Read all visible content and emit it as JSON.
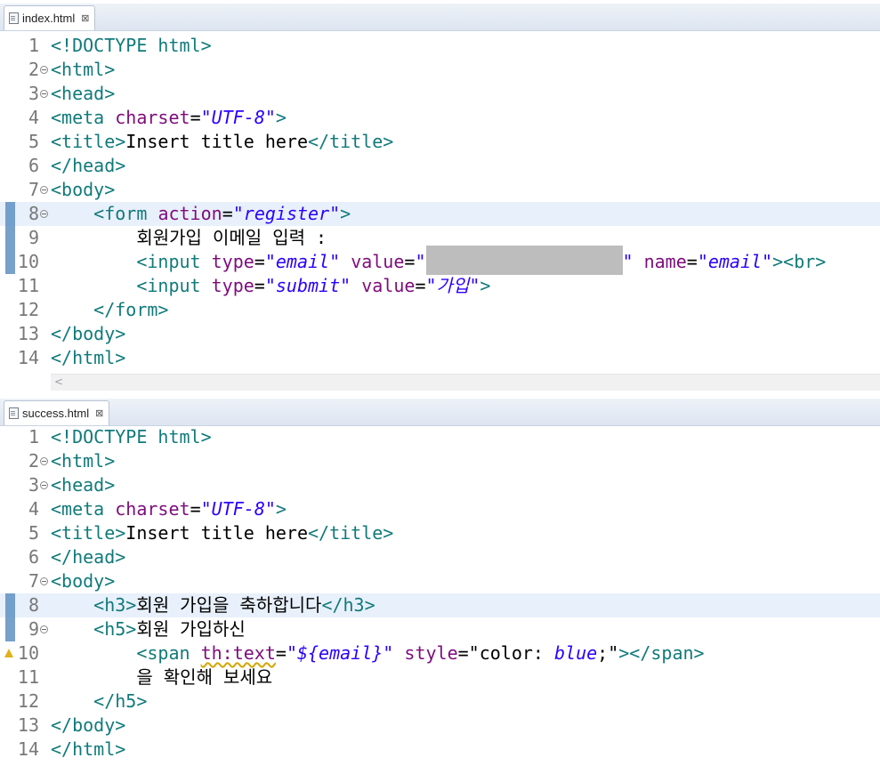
{
  "editors": [
    {
      "tab": "index.html",
      "lines": [
        {
          "n": "1",
          "fold": false,
          "mark": false,
          "html": "<span class=\"t\">&lt;!DOCTYPE</span> <span class=\"t\">html</span><span class=\"t\">&gt;</span>"
        },
        {
          "n": "2",
          "fold": true,
          "mark": false,
          "html": "<span class=\"t\">&lt;html&gt;</span>"
        },
        {
          "n": "3",
          "fold": true,
          "mark": false,
          "html": "<span class=\"t\">&lt;head&gt;</span>"
        },
        {
          "n": "4",
          "fold": false,
          "mark": false,
          "html": "<span class=\"t\">&lt;meta</span> <span class=\"a\">charset</span>=<span class=\"v\">\"UTF-8\"</span><span class=\"t\">&gt;</span>"
        },
        {
          "n": "5",
          "fold": false,
          "mark": false,
          "html": "<span class=\"t\">&lt;title&gt;</span>Insert title here<span class=\"t\">&lt;/title&gt;</span>"
        },
        {
          "n": "6",
          "fold": false,
          "mark": false,
          "html": "<span class=\"t\">&lt;/head&gt;</span>"
        },
        {
          "n": "7",
          "fold": true,
          "mark": false,
          "html": "<span class=\"t\">&lt;body&gt;</span>"
        },
        {
          "n": "8",
          "fold": true,
          "mark": true,
          "hl": true,
          "html": "    <span class=\"t\">&lt;form</span> <span class=\"a\">action</span>=<span class=\"v\">\"register\"</span><span class=\"t\">&gt;</span>"
        },
        {
          "n": "9",
          "fold": false,
          "mark": true,
          "html": "        회원가입 이메일 입력 :"
        },
        {
          "n": "10",
          "fold": false,
          "mark": true,
          "html": "        <span class=\"t\">&lt;input</span> <span class=\"a\">type</span>=<span class=\"v\">\"email\"</span> <span class=\"a\">value</span>=<span class=\"v\">\"</span><span class=\"redacted\"></span><span class=\"v\">\"</span> <span class=\"a\">name</span>=<span class=\"v\">\"email\"</span><span class=\"t\">&gt;&lt;br&gt;</span>"
        },
        {
          "n": "11",
          "fold": false,
          "mark": false,
          "html": "        <span class=\"t\">&lt;input</span> <span class=\"a\">type</span>=<span class=\"v\">\"submit\"</span> <span class=\"a\">value</span>=<span class=\"v\">\"가입\"</span><span class=\"t\">&gt;</span>"
        },
        {
          "n": "12",
          "fold": false,
          "mark": false,
          "html": "    <span class=\"t\">&lt;/form&gt;</span>"
        },
        {
          "n": "13",
          "fold": false,
          "mark": false,
          "html": "<span class=\"t\">&lt;/body&gt;</span>"
        },
        {
          "n": "14",
          "fold": false,
          "mark": false,
          "html": "<span class=\"t\">&lt;/html&gt;</span>"
        }
      ]
    },
    {
      "tab": "success.html",
      "lines": [
        {
          "n": "1",
          "fold": false,
          "mark": false,
          "html": "<span class=\"t\">&lt;!DOCTYPE</span> <span class=\"t\">html</span><span class=\"t\">&gt;</span>"
        },
        {
          "n": "2",
          "fold": true,
          "mark": false,
          "html": "<span class=\"t\">&lt;html&gt;</span>"
        },
        {
          "n": "3",
          "fold": true,
          "mark": false,
          "html": "<span class=\"t\">&lt;head&gt;</span>"
        },
        {
          "n": "4",
          "fold": false,
          "mark": false,
          "html": "<span class=\"t\">&lt;meta</span> <span class=\"a\">charset</span>=<span class=\"v\">\"UTF-8\"</span><span class=\"t\">&gt;</span>"
        },
        {
          "n": "5",
          "fold": false,
          "mark": false,
          "html": "<span class=\"t\">&lt;title&gt;</span>Insert title here<span class=\"t\">&lt;/title&gt;</span>"
        },
        {
          "n": "6",
          "fold": false,
          "mark": false,
          "html": "<span class=\"t\">&lt;/head&gt;</span>"
        },
        {
          "n": "7",
          "fold": true,
          "mark": false,
          "html": "<span class=\"t\">&lt;body&gt;</span>"
        },
        {
          "n": "8",
          "fold": false,
          "mark": true,
          "hl": true,
          "html": "    <span class=\"t\">&lt;h3&gt;</span>회원 가입을 축하합니다<span class=\"t\">&lt;/h3&gt;</span>"
        },
        {
          "n": "9",
          "fold": true,
          "mark": true,
          "html": "    <span class=\"t\">&lt;h5&gt;</span>회원 가입하신"
        },
        {
          "n": "10",
          "fold": false,
          "mark": false,
          "warn": true,
          "html": "        <span class=\"t\">&lt;span</span> <span class=\"a squiggle\">th:text</span>=<span class=\"v\">\"${email}\"</span> <span class=\"a\">style</span>=\"color: <span class=\"v\">blue</span>;\"<span class=\"t\">&gt;&lt;/span&gt;</span>"
        },
        {
          "n": "11",
          "fold": false,
          "mark": false,
          "html": "        을 확인해 보세요"
        },
        {
          "n": "12",
          "fold": false,
          "mark": false,
          "html": "    <span class=\"t\">&lt;/h5&gt;</span>"
        },
        {
          "n": "13",
          "fold": false,
          "mark": false,
          "html": "<span class=\"t\">&lt;/body&gt;</span>"
        },
        {
          "n": "14",
          "fold": false,
          "mark": false,
          "html": "<span class=\"t\">&lt;/html&gt;</span>"
        }
      ]
    }
  ],
  "scroll_left_glyph": "<"
}
